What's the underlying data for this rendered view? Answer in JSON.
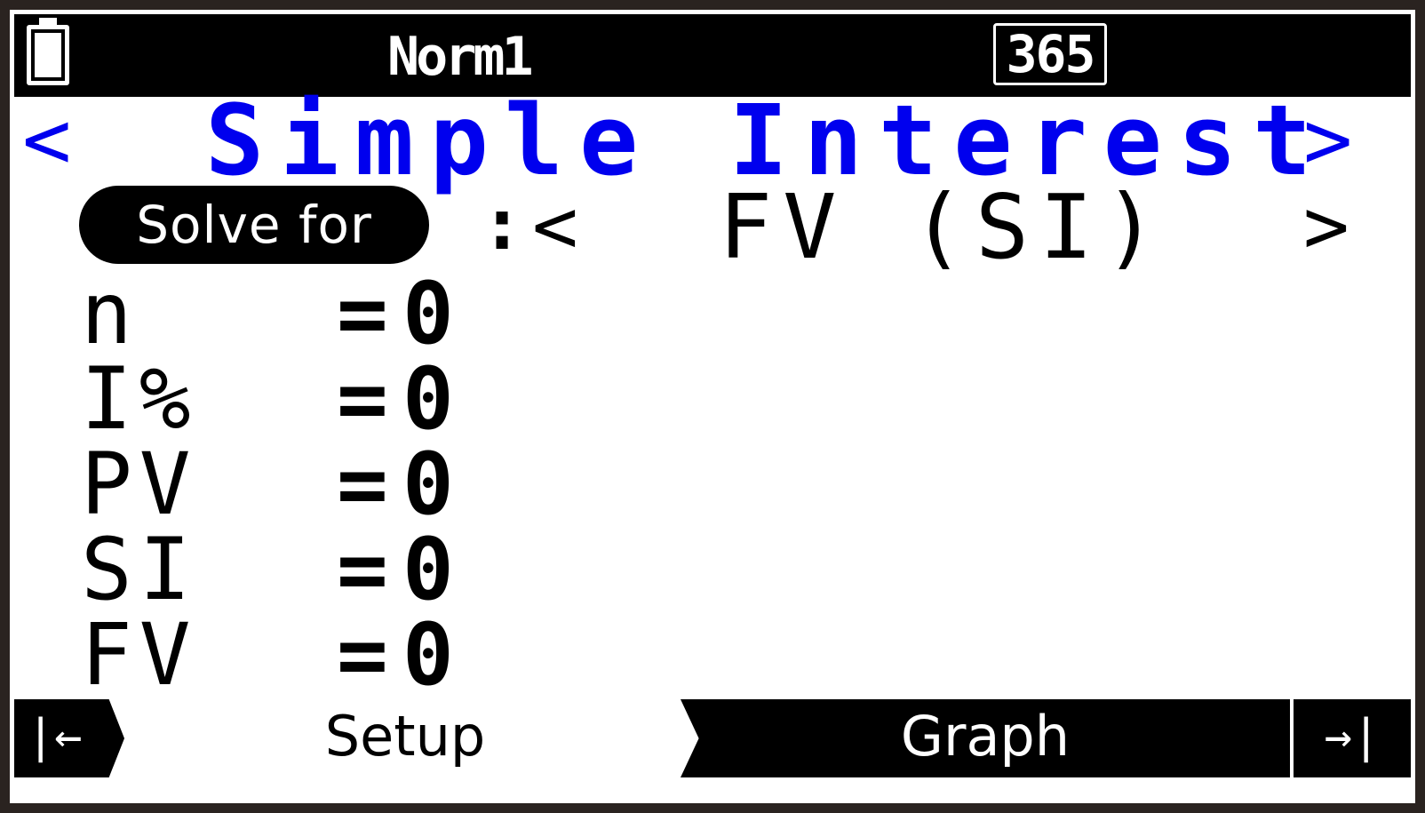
{
  "statusbar": {
    "battery_icon": "battery-icon",
    "mode": "Norm1",
    "days_mode": "365"
  },
  "header": {
    "left_arrow": "<",
    "title": "Simple Interest",
    "right_arrow": ">"
  },
  "solve_for": {
    "label": "Solve for",
    "colon": ":",
    "left_arrow": "<",
    "value": "FV (SI)",
    "right_arrow": ">"
  },
  "variables": [
    {
      "name": "n",
      "eq": "=",
      "value": "0"
    },
    {
      "name": "I%",
      "eq": "=",
      "value": "0"
    },
    {
      "name": "PV",
      "eq": "=",
      "value": "0"
    },
    {
      "name": "SI",
      "eq": "=",
      "value": "0"
    },
    {
      "name": "FV",
      "eq": "=",
      "value": "0"
    }
  ],
  "function_bar": {
    "back": "|←",
    "setup": "Setup",
    "graph": "Graph",
    "end": "→|"
  },
  "colors": {
    "accent_blue": "#0000ee",
    "background": "#ffffff",
    "bar": "#000000"
  }
}
